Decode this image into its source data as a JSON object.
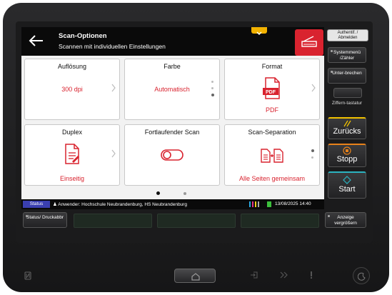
{
  "header": {
    "title": "Scan-Optionen",
    "subtitle": "Scannen mit individuellen Einstellungen"
  },
  "tiles": [
    {
      "label": "Auflösung",
      "value": "300 dpi"
    },
    {
      "label": "Farbe",
      "value": "Automatisch"
    },
    {
      "label": "Format",
      "value": "PDF",
      "icon_text": "PDF"
    },
    {
      "label": "Duplex",
      "value": "Einseitig"
    },
    {
      "label": "Fortlaufender Scan",
      "value": ""
    },
    {
      "label": "Scan-Separation",
      "value": "Alle Seiten gemeinsam"
    }
  ],
  "pager": {
    "current_page": 1,
    "total_pages": 2
  },
  "status_bar": {
    "status_label": "Status",
    "user": "Anwender: Hochschule Neubrandenburg, HS Neubrandenburg",
    "date": "13/08/2025",
    "time": "14:40"
  },
  "side_panel": {
    "auth_label": "Authentif. / Abmelden",
    "systemmenu_label": "Systemmenü /Zähler",
    "unterbrechen_label": "Unter-brechen",
    "ziffern_label": "Ziffern-tastatur",
    "zurueck_label": "Zurücks",
    "stopp_label": "Stopp",
    "start_label": "Start"
  },
  "bottom": {
    "status_button_label": "Status/ Druckabbr",
    "zoom_button_label": "Anzeige vergrößern"
  },
  "colors": {
    "accent_red": "#d9232f",
    "stop_orange": "#e8821a",
    "start_teal": "#2bb3c0",
    "back_yellow": "#f2c200",
    "status_blue": "#3a3fb0"
  },
  "icons": {
    "back": "back-arrow-icon",
    "scanner": "scanner-icon",
    "pdf": "pdf-document-icon",
    "duplex": "single-sided-document-icon",
    "toggle": "toggle-switch-icon",
    "separation": "scan-separation-icon",
    "home": "home-icon",
    "energy": "power-icon"
  }
}
